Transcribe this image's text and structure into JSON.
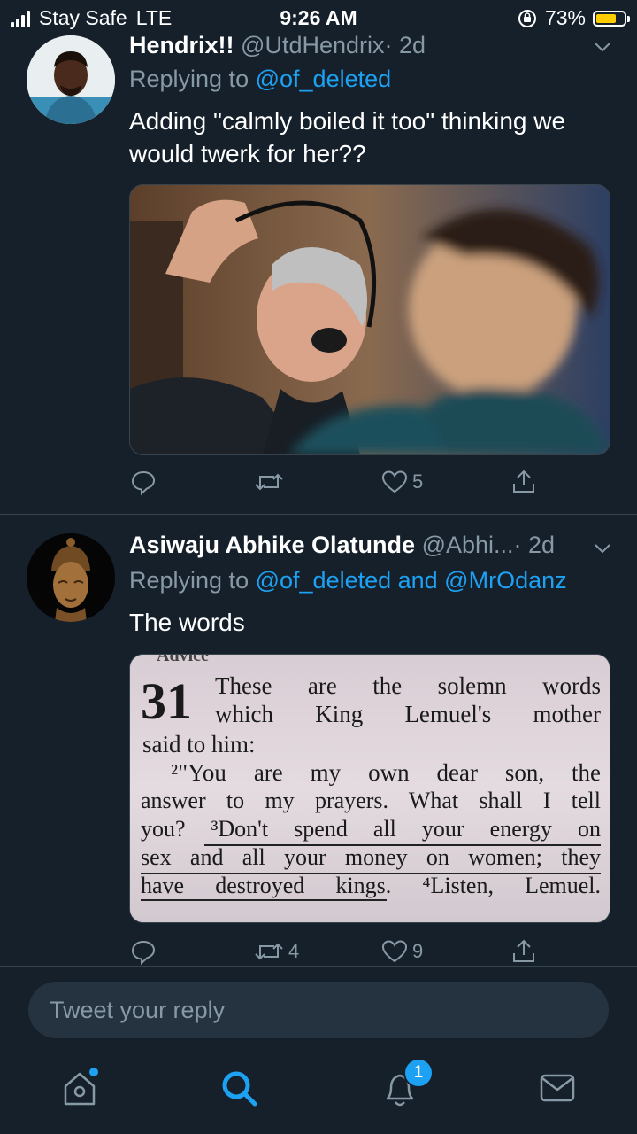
{
  "status_bar": {
    "carrier": "Stay Safe",
    "network": "LTE",
    "time": "9:26 AM",
    "battery": "73%",
    "battery_level": 0.73
  },
  "tweets": [
    {
      "display_name": "Hendrix!!",
      "handle": "@UtdHendrix",
      "time": "· 2d",
      "replying_prefix": "Replying to",
      "replying_to": "@of_deleted",
      "text": "Adding \"calmly boiled it too\" thinking we would twerk for her??",
      "media_icon": "photo-of-man-with-headset",
      "actions": {
        "reply_count": "",
        "retweet_count": "",
        "like_count": "5"
      }
    },
    {
      "display_name": "Asiwaju Abhike Olatunde",
      "handle": "@Abhi...",
      "time": "· 2d",
      "replying_prefix": "Replying to",
      "replying_to": "@of_deleted and @MrOdanz",
      "text": "The words",
      "media": {
        "header_fragment": "Advice",
        "verse_number": "31",
        "lines": [
          "These are the solemn words",
          "which King Lemuel's mother",
          "said to him:",
          "²\"You are my own dear son, the",
          "answer to my prayers. What shall I tell",
          "you? ³Don't spend all your energy on",
          "sex and all your money on women; they",
          "have destroyed kings. ⁴Listen, Lemuel."
        ]
      },
      "actions": {
        "reply_count": "",
        "retweet_count": "4",
        "like_count": "9"
      }
    }
  ],
  "reply_box": {
    "placeholder": "Tweet your reply"
  },
  "tab_bar": {
    "items": [
      "home-icon",
      "search-icon",
      "notifications-icon",
      "messages-icon"
    ],
    "notifications_badge": "1",
    "accent": "#1da1f2"
  },
  "colors": {
    "background": "#15202b",
    "muted": "#8899a6",
    "link": "#1da1f2",
    "divider": "#38444d"
  }
}
